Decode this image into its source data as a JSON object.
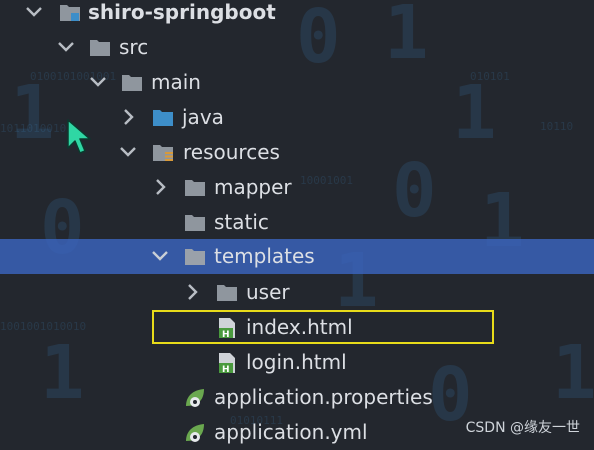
{
  "tree": {
    "items": [
      {
        "key": "project",
        "label": "shiro-springboot",
        "expanded": true,
        "selected": false,
        "icon": "project-module-icon"
      },
      {
        "key": "src",
        "label": "src",
        "expanded": true,
        "selected": false,
        "icon": "folder-icon"
      },
      {
        "key": "main",
        "label": "main",
        "expanded": true,
        "selected": false,
        "icon": "folder-icon"
      },
      {
        "key": "java",
        "label": "java",
        "expanded": false,
        "selected": false,
        "icon": "source-root-folder-icon"
      },
      {
        "key": "resources",
        "label": "resources",
        "expanded": true,
        "selected": false,
        "icon": "resources-folder-icon"
      },
      {
        "key": "mapper",
        "label": "mapper",
        "expanded": false,
        "selected": false,
        "icon": "folder-icon"
      },
      {
        "key": "static",
        "label": "static",
        "expanded": null,
        "selected": false,
        "icon": "folder-icon"
      },
      {
        "key": "templates",
        "label": "templates",
        "expanded": true,
        "selected": true,
        "icon": "folder-icon"
      },
      {
        "key": "user",
        "label": "user",
        "expanded": false,
        "selected": false,
        "icon": "folder-icon"
      },
      {
        "key": "index",
        "label": "index.html",
        "expanded": null,
        "selected": false,
        "icon": "html-file-icon"
      },
      {
        "key": "login",
        "label": "login.html",
        "expanded": null,
        "selected": false,
        "icon": "html-file-icon"
      },
      {
        "key": "props",
        "label": "application.properties",
        "expanded": null,
        "selected": false,
        "icon": "spring-config-file-icon"
      },
      {
        "key": "yml",
        "label": "application.yml",
        "expanded": null,
        "selected": false,
        "icon": "spring-config-file-icon"
      }
    ]
  },
  "highlighted_item": "index.html",
  "watermark": "CSDN @缘友一世",
  "colors": {
    "background": "#23272e",
    "selection": "#3a64be",
    "highlight_border": "#e8db1a",
    "folder": "#8f969e",
    "source_folder": "#3d8ec9",
    "html_icon": "#4a9a3e",
    "spring_icon": "#6aa84f"
  }
}
